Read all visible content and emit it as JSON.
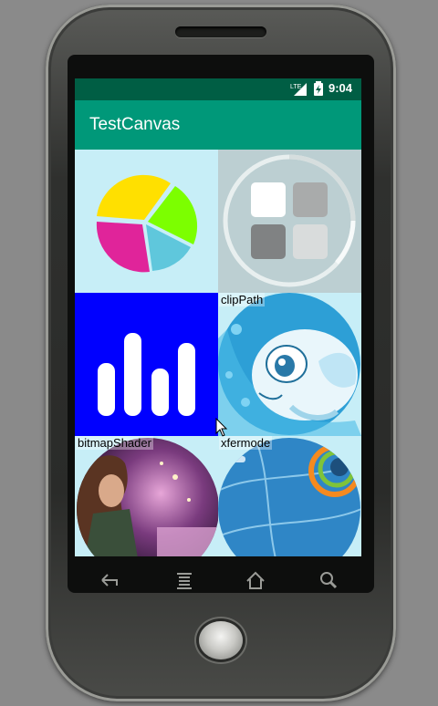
{
  "status_bar": {
    "network": "LTE",
    "time": "9:04"
  },
  "app_bar": {
    "title": "TestCanvas"
  },
  "tiles": [
    {
      "label": ""
    },
    {
      "label": ""
    },
    {
      "label": ""
    },
    {
      "label": "clipPath"
    },
    {
      "label": "bitmapShader"
    },
    {
      "label": "xfermode"
    }
  ],
  "colors": {
    "status_bar": "#005e44",
    "app_bar": "#009879",
    "tile_bg": "#c7eef7",
    "bar_tile_bg": "#0000ff"
  },
  "nav": {
    "icons": [
      "back-icon",
      "menu-icon",
      "home-icon",
      "search-icon"
    ]
  }
}
